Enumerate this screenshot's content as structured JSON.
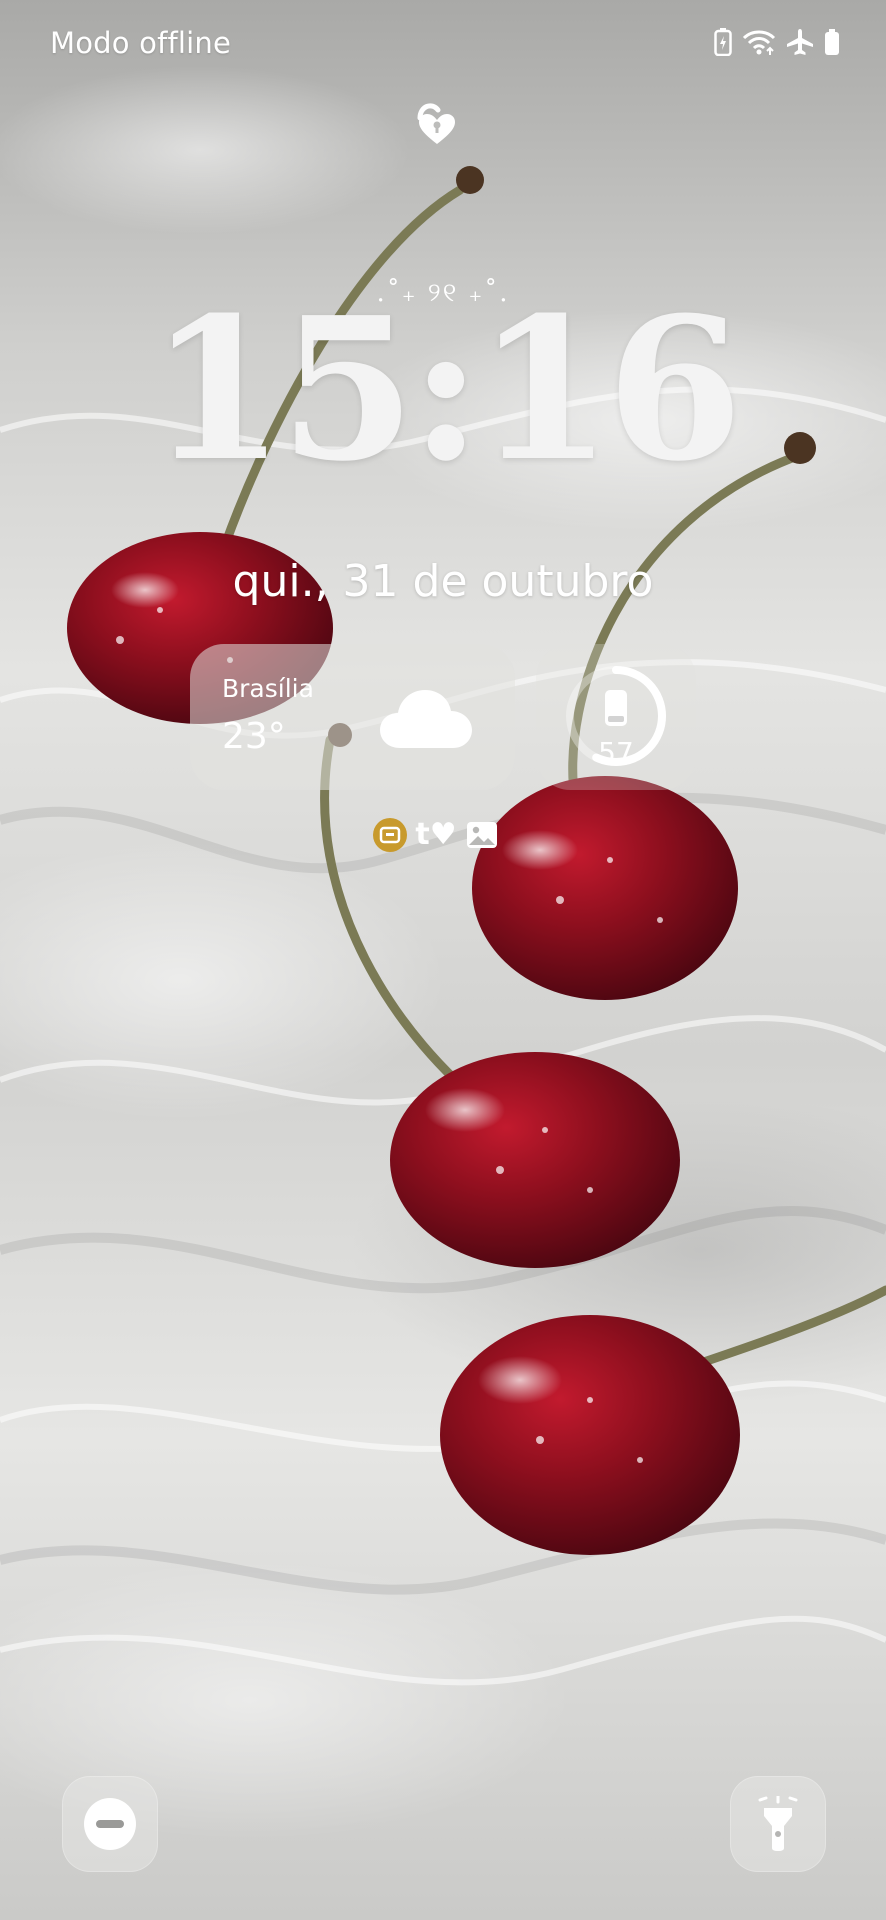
{
  "status_bar": {
    "carrier_text": "Modo offline",
    "icons": [
      "battery-saver-icon",
      "wifi-icon",
      "airplane-mode-icon",
      "battery-icon"
    ]
  },
  "lock": {
    "icon": "heart-lock-unlocked-icon"
  },
  "clock": {
    "decoration": ".˚₊ ୨୧ ₊˚.",
    "time": "15:16",
    "date": "qui., 31 de outubro"
  },
  "weather": {
    "city": "Brasília",
    "temperature": "23°",
    "condition_icon": "cloud-icon"
  },
  "battery_widget": {
    "level": "57",
    "level_fraction": 0.57,
    "icon": "phone-battery-icon"
  },
  "notifications": {
    "icons": [
      "app-notification-icon",
      "tumblr-icon",
      "gallery-icon"
    ],
    "tumblr_glyph": "t♥",
    "accent_color": "#c89a2c"
  },
  "shortcuts": {
    "left": "do-not-disturb-icon",
    "right": "flashlight-icon"
  }
}
